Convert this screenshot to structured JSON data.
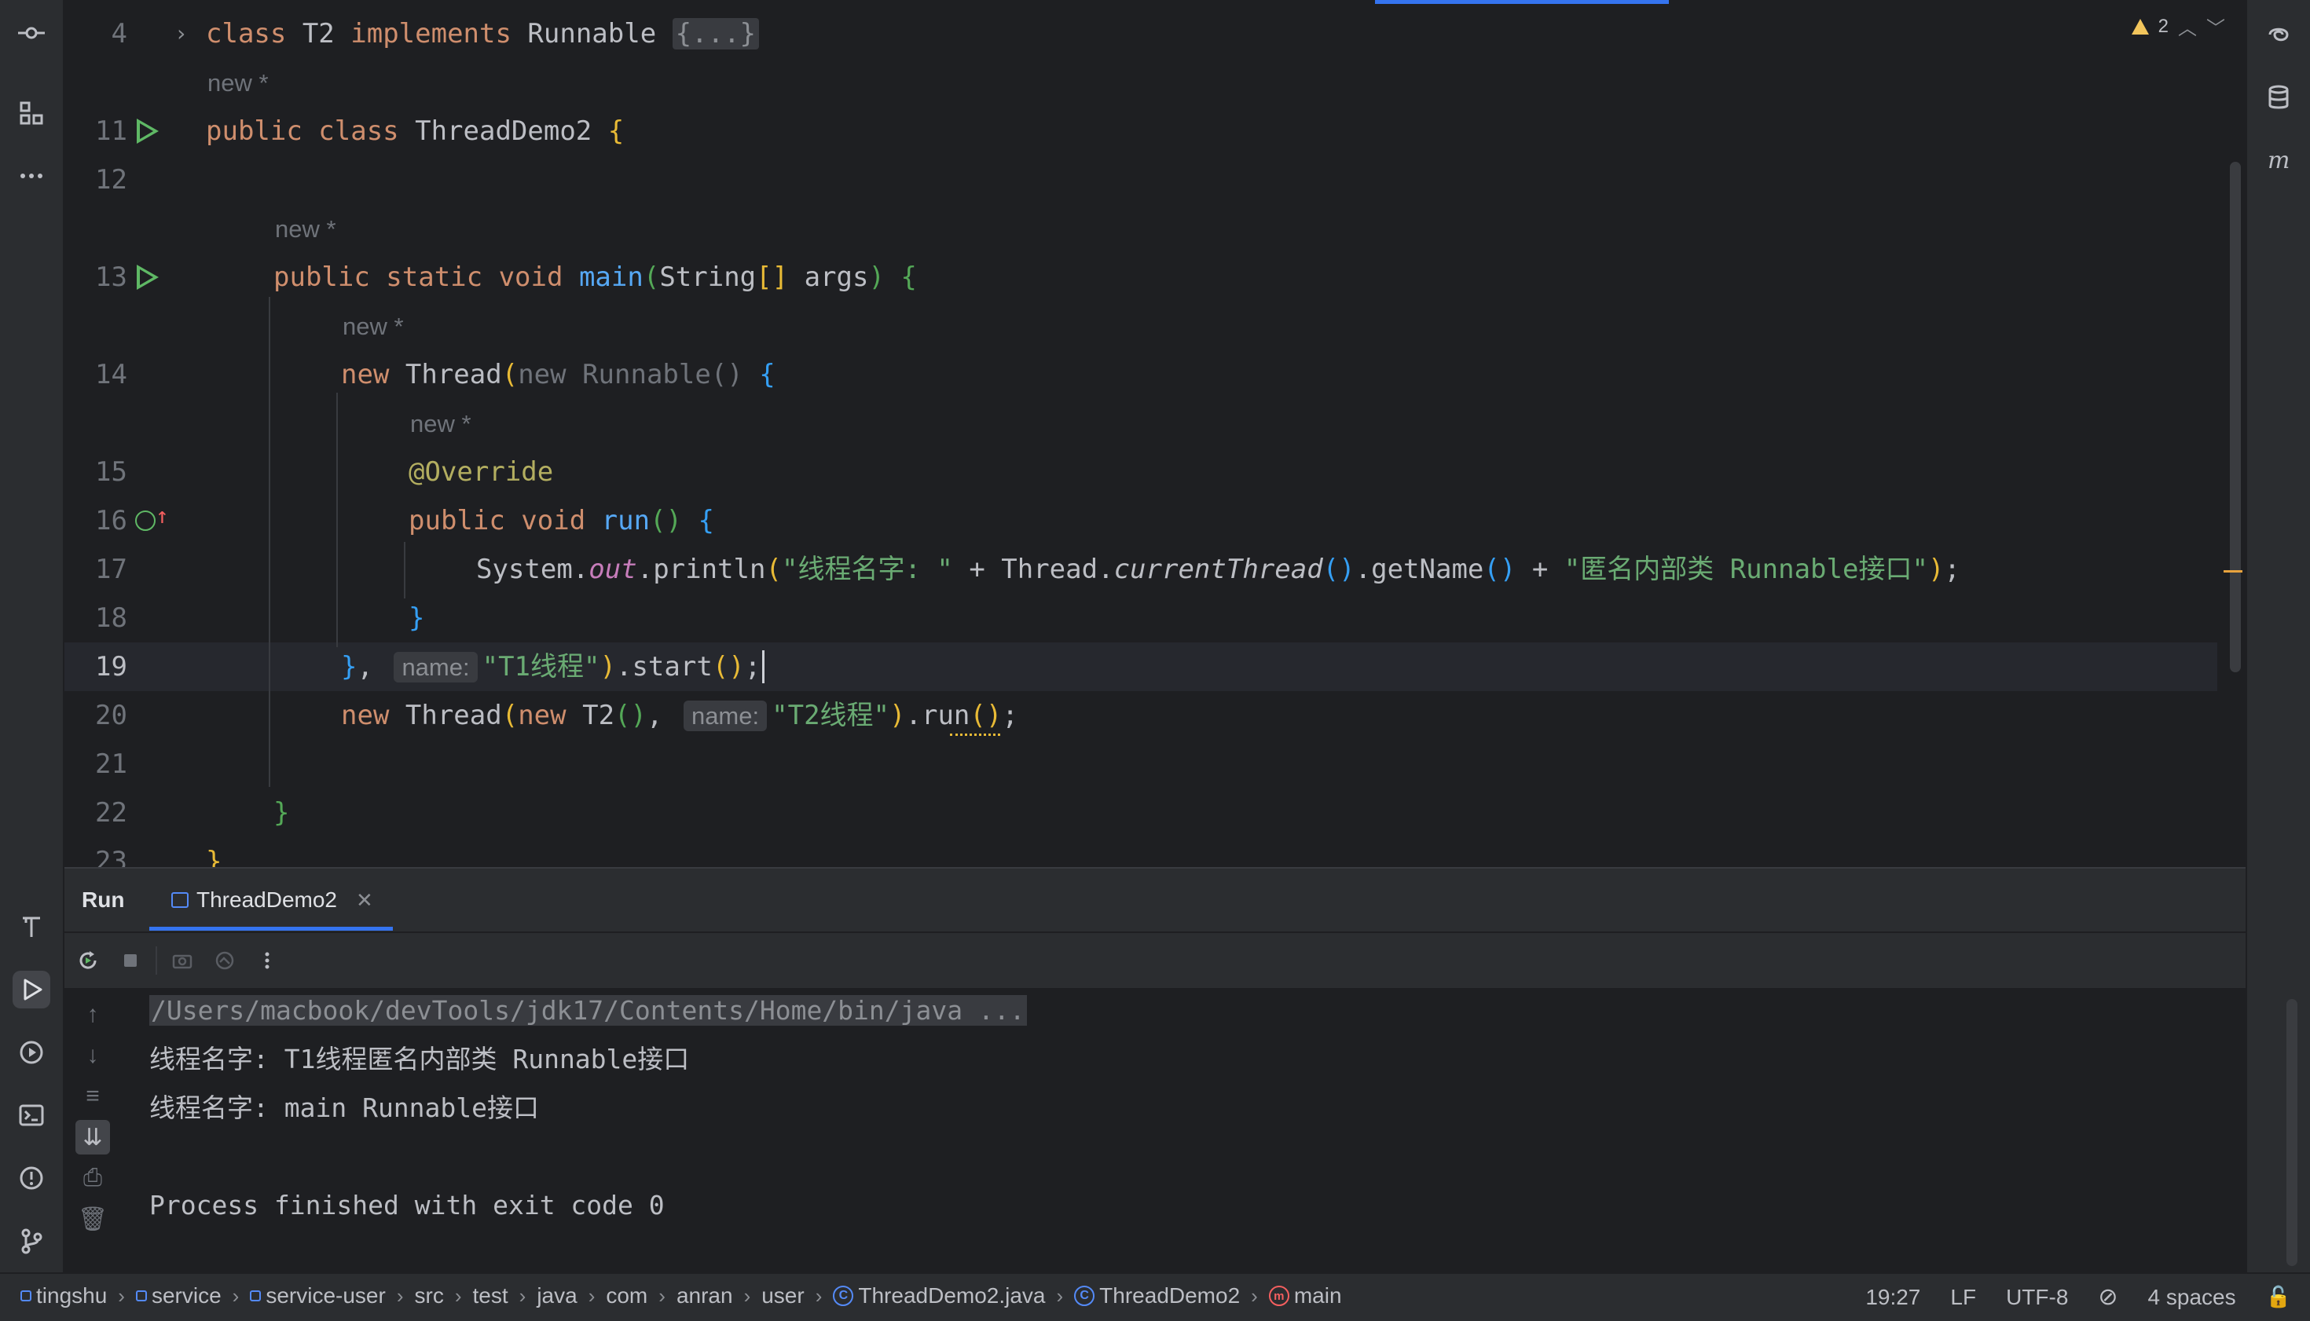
{
  "editor": {
    "warnings_count": "2",
    "lines": [
      {
        "num": "4",
        "parts": [
          [
            "kw",
            "class "
          ],
          [
            "",
            "T2 "
          ],
          [
            "kw",
            "implements "
          ],
          [
            "",
            "Runnable "
          ],
          [
            "fold",
            "{...}"
          ]
        ]
      },
      {
        "inlay": "new *",
        "indent": 0
      },
      {
        "num": "11",
        "parts": [
          [
            "kw",
            "public class "
          ],
          [
            "",
            "ThreadDemo2 "
          ],
          [
            "br1",
            "{"
          ]
        ]
      },
      {
        "num": "12",
        "parts": []
      },
      {
        "inlay": "new *",
        "indent": 1
      },
      {
        "num": "13",
        "parts": [
          [
            "kw",
            "public static void "
          ],
          [
            "fn",
            "main"
          ],
          [
            "br2",
            "("
          ],
          [
            "",
            "String"
          ],
          [
            "br1",
            "[]"
          ],
          [
            "",
            " args"
          ],
          [
            "br2",
            ")"
          ],
          [
            "",
            " "
          ],
          [
            "br2",
            "{"
          ]
        ]
      },
      {
        "inlay": "new *",
        "indent": 2
      },
      {
        "num": "14",
        "parts": [
          [
            "kw",
            "new "
          ],
          [
            "",
            "Thread"
          ],
          [
            "br1",
            "("
          ],
          [
            "dim",
            "new Runnable() "
          ],
          [
            "br3",
            "{"
          ]
        ]
      },
      {
        "inlay": "new *",
        "indent": 3
      },
      {
        "num": "15",
        "parts": [
          [
            "ann",
            "@Override"
          ]
        ]
      },
      {
        "num": "16",
        "parts": [
          [
            "kw",
            "public void "
          ],
          [
            "fn",
            "run"
          ],
          [
            "br2",
            "()"
          ],
          [
            "",
            " "
          ],
          [
            "br3",
            "{"
          ]
        ]
      },
      {
        "num": "17",
        "parts": [
          [
            "",
            "System."
          ],
          [
            "field",
            "out"
          ],
          [
            "",
            ".println"
          ],
          [
            "br1",
            "("
          ],
          [
            "str",
            "\"线程名字: \""
          ],
          [
            "",
            " + Thread."
          ],
          [
            "ital",
            "currentThread"
          ],
          [
            "br3",
            "()"
          ],
          [
            "",
            ".getName"
          ],
          [
            "br3",
            "()"
          ],
          [
            "",
            " + "
          ],
          [
            "str",
            "\"匿名内部类 Runnable接口\""
          ],
          [
            "br1",
            ")"
          ],
          [
            "",
            ";"
          ]
        ]
      },
      {
        "num": "18",
        "parts": [
          [
            "br3",
            "}"
          ]
        ]
      },
      {
        "num": "19",
        "parts": [
          [
            "br3",
            "}"
          ],
          [
            "",
            ", "
          ],
          [
            "hint",
            "name:"
          ],
          [
            "str",
            "\"T1线程\""
          ],
          [
            "br1",
            ")"
          ],
          [
            "",
            ".start"
          ],
          [
            "br1",
            "()"
          ],
          [
            "",
            ";"
          ]
        ]
      },
      {
        "num": "20",
        "parts": [
          [
            "kw",
            "new "
          ],
          [
            "",
            "Thread"
          ],
          [
            "br1",
            "("
          ],
          [
            "kw",
            "new "
          ],
          [
            "",
            "T2"
          ],
          [
            "br2",
            "()"
          ],
          [
            "",
            ", "
          ],
          [
            "hint",
            "name:"
          ],
          [
            "str",
            "\"T2线程\""
          ],
          [
            "br1",
            ")"
          ],
          [
            "",
            ".run"
          ],
          [
            "br1",
            "()"
          ],
          [
            "",
            ";"
          ]
        ]
      },
      {
        "num": "21",
        "parts": []
      },
      {
        "num": "22",
        "parts": [
          [
            "br2",
            "}"
          ]
        ]
      },
      {
        "num": "23",
        "parts": [
          [
            "br1",
            "}"
          ]
        ]
      }
    ]
  },
  "run_panel": {
    "title": "Run",
    "tab_label": "ThreadDemo2",
    "console_lines": [
      "/Users/macbook/devTools/jdk17/Contents/Home/bin/java ...",
      "线程名字: T1线程匿名内部类 Runnable接口",
      "线程名字: main Runnable接口",
      "",
      "Process finished with exit code 0"
    ]
  },
  "status_bar": {
    "breadcrumbs": [
      "tingshu",
      "service",
      "service-user",
      "src",
      "test",
      "java",
      "com",
      "anran",
      "user",
      "ThreadDemo2.java",
      "ThreadDemo2",
      "main"
    ],
    "position": "19:27",
    "line_ending": "LF",
    "encoding": "UTF-8",
    "indent": "4 spaces"
  },
  "colors": {
    "accent": "#3574f0",
    "keyword": "#cf8e6d",
    "string": "#6aab73",
    "run_green": "#5fb865"
  }
}
